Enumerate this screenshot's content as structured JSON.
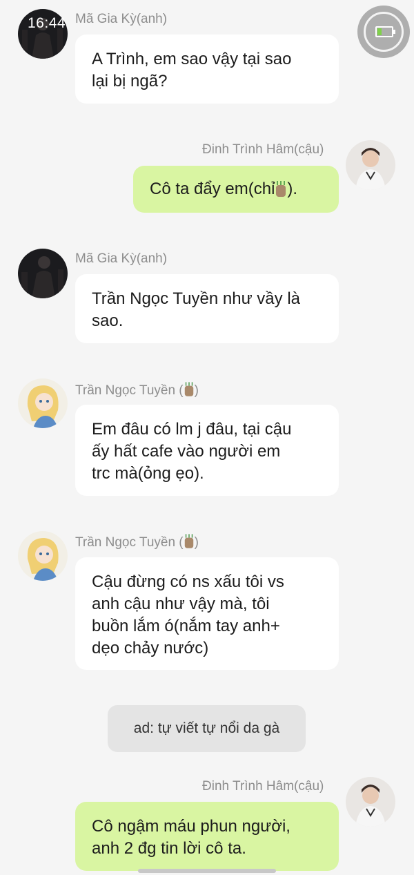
{
  "status_bar": {
    "time": "16:44"
  },
  "messages": [
    {
      "sender": "Mã Gia Kỳ(anh)",
      "side": "left",
      "lines": [
        "A Trình, em sao vậy tại sao",
        "lại bị ngã?"
      ]
    },
    {
      "sender": "Đinh Trình Hâm(cậu)",
      "side": "right",
      "lines": [
        "Cô ta đẩy em(chỉ",
        ")."
      ]
    },
    {
      "sender": "Mã Gia Kỳ(anh)",
      "side": "left",
      "lines": [
        "Trần Ngọc Tuyền như vầy là",
        "sao."
      ]
    },
    {
      "sender": "Trần Ngọc Tuyền (",
      "sender_suffix": ")",
      "side": "left",
      "lines": [
        "Em đâu có lm j đâu, tại cậu",
        "ấy hất cafe vào người em",
        "trc mà(ỏng ẹo)."
      ]
    },
    {
      "sender": "Trần Ngọc Tuyền (",
      "sender_suffix": ")",
      "side": "left",
      "lines": [
        "Cậu đừng có ns xấu tôi vs",
        "anh cậu như vậy mà, tôi",
        "buồn lắm ó(nắm tay anh+",
        "dẹo chảy nước)"
      ]
    },
    {
      "sender": "Đinh Trình Hâm(cậu)",
      "side": "right",
      "lines": [
        "Cô ngậm máu phun người,",
        "anh 2 đg tin lời cô ta."
      ]
    }
  ],
  "note": {
    "text": "ad: tự viết tự nổi da gà"
  },
  "icons": [
    "battery-icon",
    "coffee-cup-emoji",
    "avatar"
  ],
  "colors": {
    "background": "#f5f5f5",
    "left_bubble": "#ffffff",
    "right_bubble": "#d9f5a2",
    "sender_text": "#8d8d8d"
  }
}
